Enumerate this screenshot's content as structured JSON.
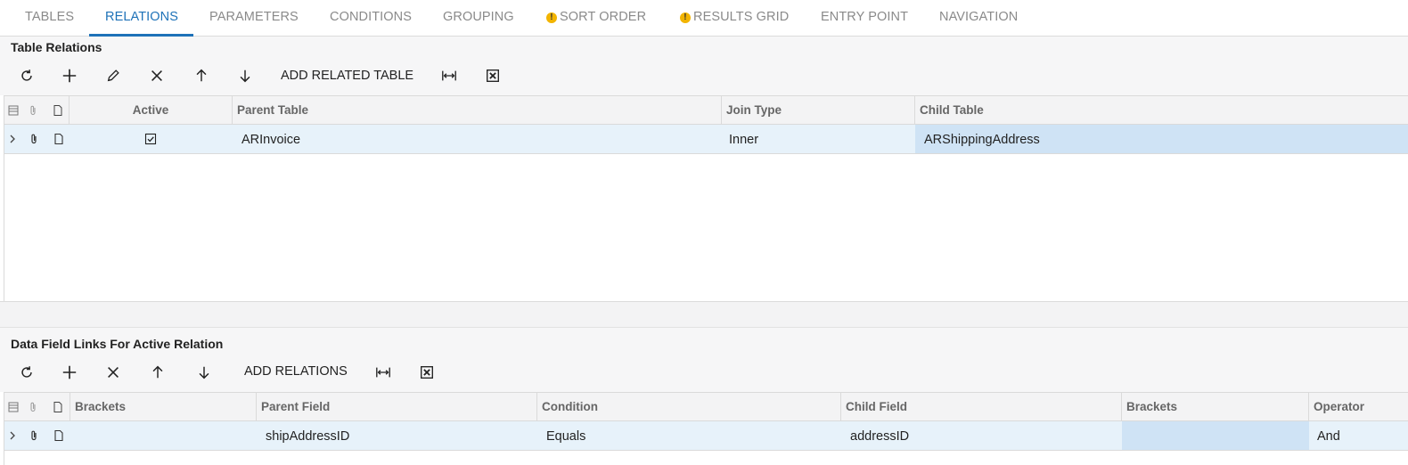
{
  "tabs": [
    {
      "label": "TABLES",
      "active": false,
      "warning": false
    },
    {
      "label": "RELATIONS",
      "active": true,
      "warning": false
    },
    {
      "label": "PARAMETERS",
      "active": false,
      "warning": false
    },
    {
      "label": "CONDITIONS",
      "active": false,
      "warning": false
    },
    {
      "label": "GROUPING",
      "active": false,
      "warning": false
    },
    {
      "label": "SORT ORDER",
      "active": false,
      "warning": true
    },
    {
      "label": "RESULTS GRID",
      "active": false,
      "warning": true
    },
    {
      "label": "ENTRY POINT",
      "active": false,
      "warning": false
    },
    {
      "label": "NAVIGATION",
      "active": false,
      "warning": false
    }
  ],
  "warning_glyph": "!",
  "table_relations": {
    "title": "Table Relations",
    "toolbar": {
      "icons": [
        "refresh-icon",
        "add-icon",
        "edit-icon",
        "delete-icon",
        "move-up-icon",
        "move-down-icon"
      ],
      "add_label": "ADD RELATED TABLE",
      "fit_icon": "fit-to-screen-icon",
      "excel_icon": "export-excel-icon"
    },
    "columns": [
      "Active",
      "Parent Table",
      "Join Type",
      "Child Table"
    ],
    "rows": [
      {
        "active": true,
        "parent_table": "ARInvoice",
        "join_type": "Inner",
        "child_table": "ARShippingAddress"
      }
    ]
  },
  "data_field_links": {
    "title": "Data Field Links For Active Relation",
    "toolbar": {
      "icons": [
        "refresh-icon",
        "add-icon",
        "delete-icon",
        "move-up-icon",
        "move-down-icon"
      ],
      "add_label": "ADD RELATIONS",
      "fit_icon": "fit-to-screen-icon",
      "excel_icon": "export-excel-icon"
    },
    "columns": [
      "Brackets",
      "Parent Field",
      "Condition",
      "Child Field",
      "Brackets",
      "Operator"
    ],
    "rows": [
      {
        "brackets_open": "",
        "parent_field": "shipAddressID",
        "condition": "Equals",
        "child_field": "addressID",
        "brackets_close": "",
        "operator": "And"
      }
    ]
  },
  "colors": {
    "accent": "#1e72b8",
    "row_highlight": "#e7f2fa",
    "selected_cell": "#cfe3f5",
    "warning": "#f2b400"
  }
}
